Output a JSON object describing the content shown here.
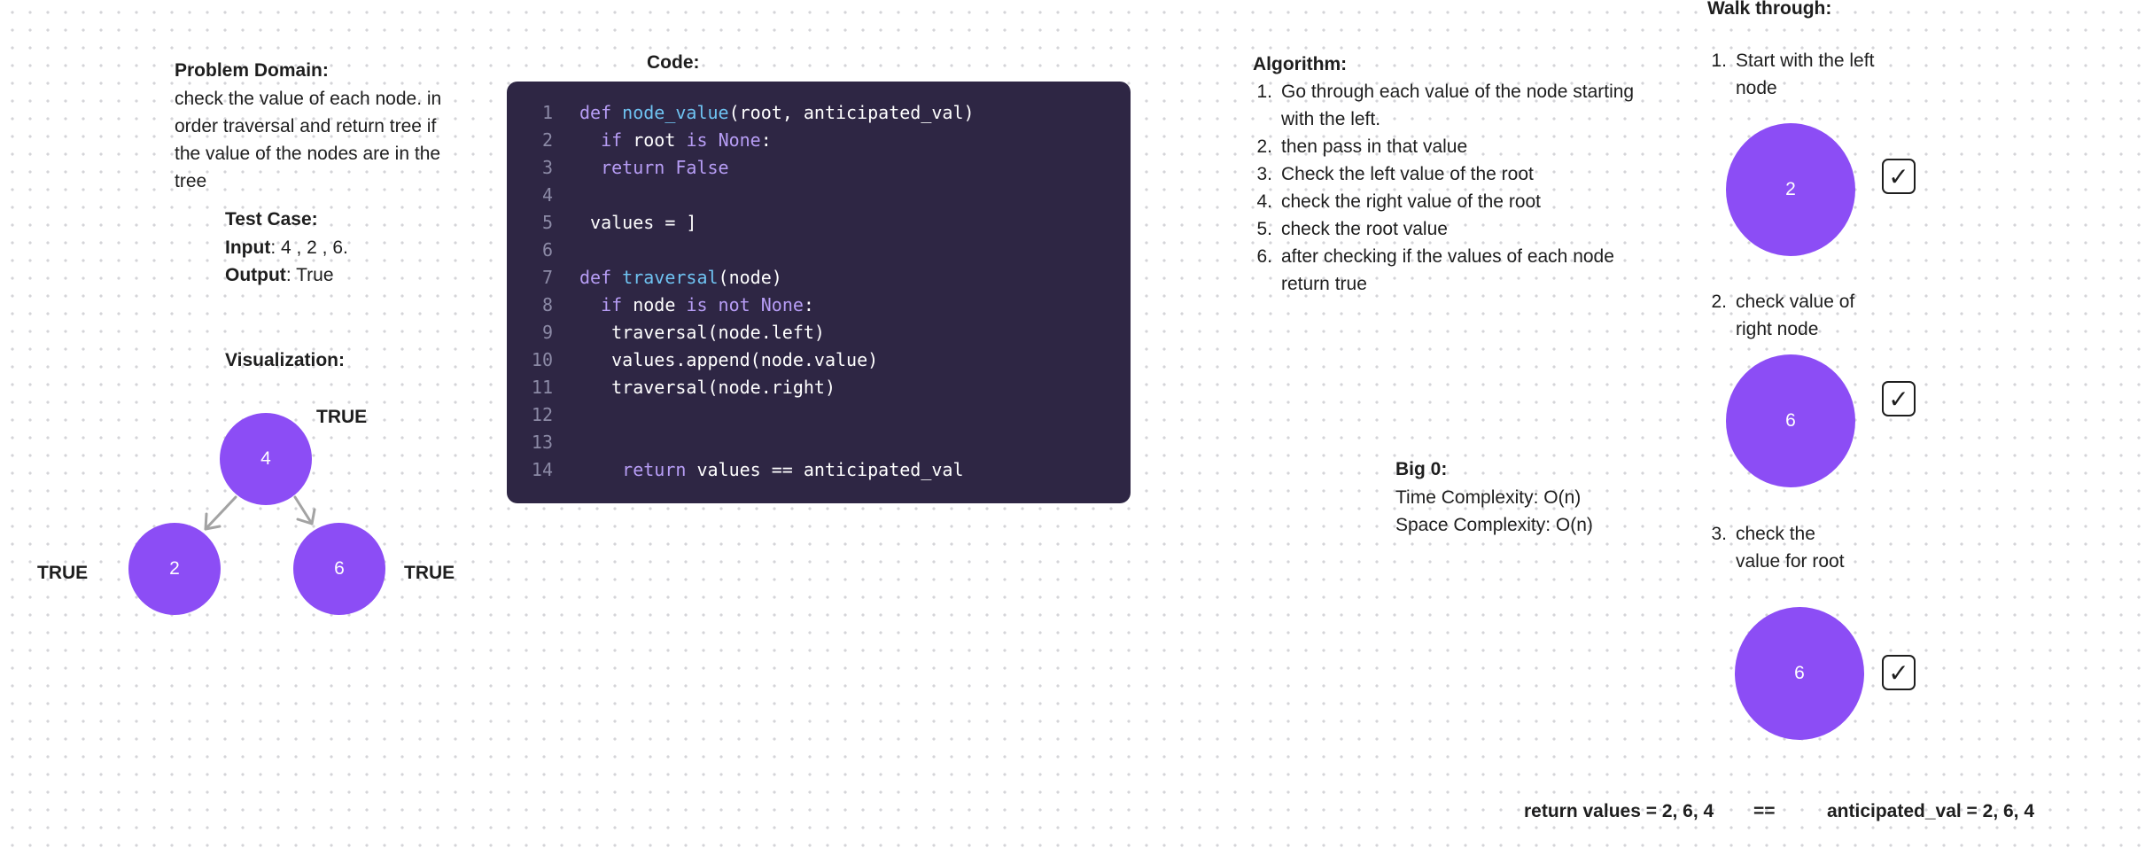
{
  "problem": {
    "heading": "Problem Domain:",
    "text": "check the value of each node. in order traversal and return tree if the value of the nodes are in the tree"
  },
  "test_case": {
    "heading": "Test Case:",
    "input_label": "Input",
    "input_value": ": 4 , 2 ,  6.",
    "output_label": "Output",
    "output_value": ": True"
  },
  "visualization": {
    "heading": "Visualization:",
    "root": "4",
    "left": "2",
    "right": "6",
    "root_label": "TRUE",
    "left_label": "TRUE",
    "right_label": "TRUE",
    "node_color": "#8c4df5"
  },
  "code": {
    "heading": "Code:",
    "line_numbers": [
      "1",
      "2",
      "3",
      "4",
      "5",
      "6",
      "7",
      "8",
      "9",
      "10",
      "11",
      "12",
      "13",
      "14"
    ],
    "l1": {
      "a": "def ",
      "b": "node_value",
      "c": "(root, anticipated_val)"
    },
    "l2": {
      "a": "  if ",
      "b": "root ",
      "c": "is ",
      "d": "None",
      "e": ":"
    },
    "l3": {
      "a": "  return False"
    },
    "l5": {
      "a": " values = ]"
    },
    "l7": {
      "a": "def ",
      "b": "traversal",
      "c": "(node)"
    },
    "l8": {
      "a": "  if ",
      "b": "node ",
      "c": "is not ",
      "d": "None",
      "e": ":"
    },
    "l9": {
      "a": "   traversal(node.left)"
    },
    "l10": {
      "a": "   values.append(node.value)"
    },
    "l11": {
      "a": "   traversal(node.right)"
    },
    "l14": {
      "a": "    return ",
      "b": "values == anticipated_val"
    }
  },
  "algorithm": {
    "heading": "Algorithm:",
    "steps": [
      {
        "n": "1.",
        "text": "Go through each value of the node starting with the left."
      },
      {
        "n": "2.",
        "text": "then pass in that value"
      },
      {
        "n": "3.",
        "text": "Check the left value of the root"
      },
      {
        "n": "4.",
        "text": "check the right value of the root"
      },
      {
        "n": "5.",
        "text": "check the root value"
      },
      {
        "n": "6.",
        "text": "after checking if the values of each node return true"
      }
    ]
  },
  "big_o": {
    "heading": "Big 0:",
    "time": "Time Complexity: O(n)",
    "space": "Space Complexity: O(n)"
  },
  "walkthrough": {
    "heading": "Walk through:",
    "steps": [
      {
        "n": "1.",
        "text": "Start with the left node",
        "node": "2"
      },
      {
        "n": "2.",
        "text": "check value of right node",
        "node": "6"
      },
      {
        "n": "3.",
        "text": "check the value for root",
        "node": "6"
      }
    ],
    "check_icon": "check-icon"
  },
  "result": {
    "left": "return values = 2, 6, 4",
    "op": "==",
    "right": "anticipated_val = 2, 6, 4"
  }
}
